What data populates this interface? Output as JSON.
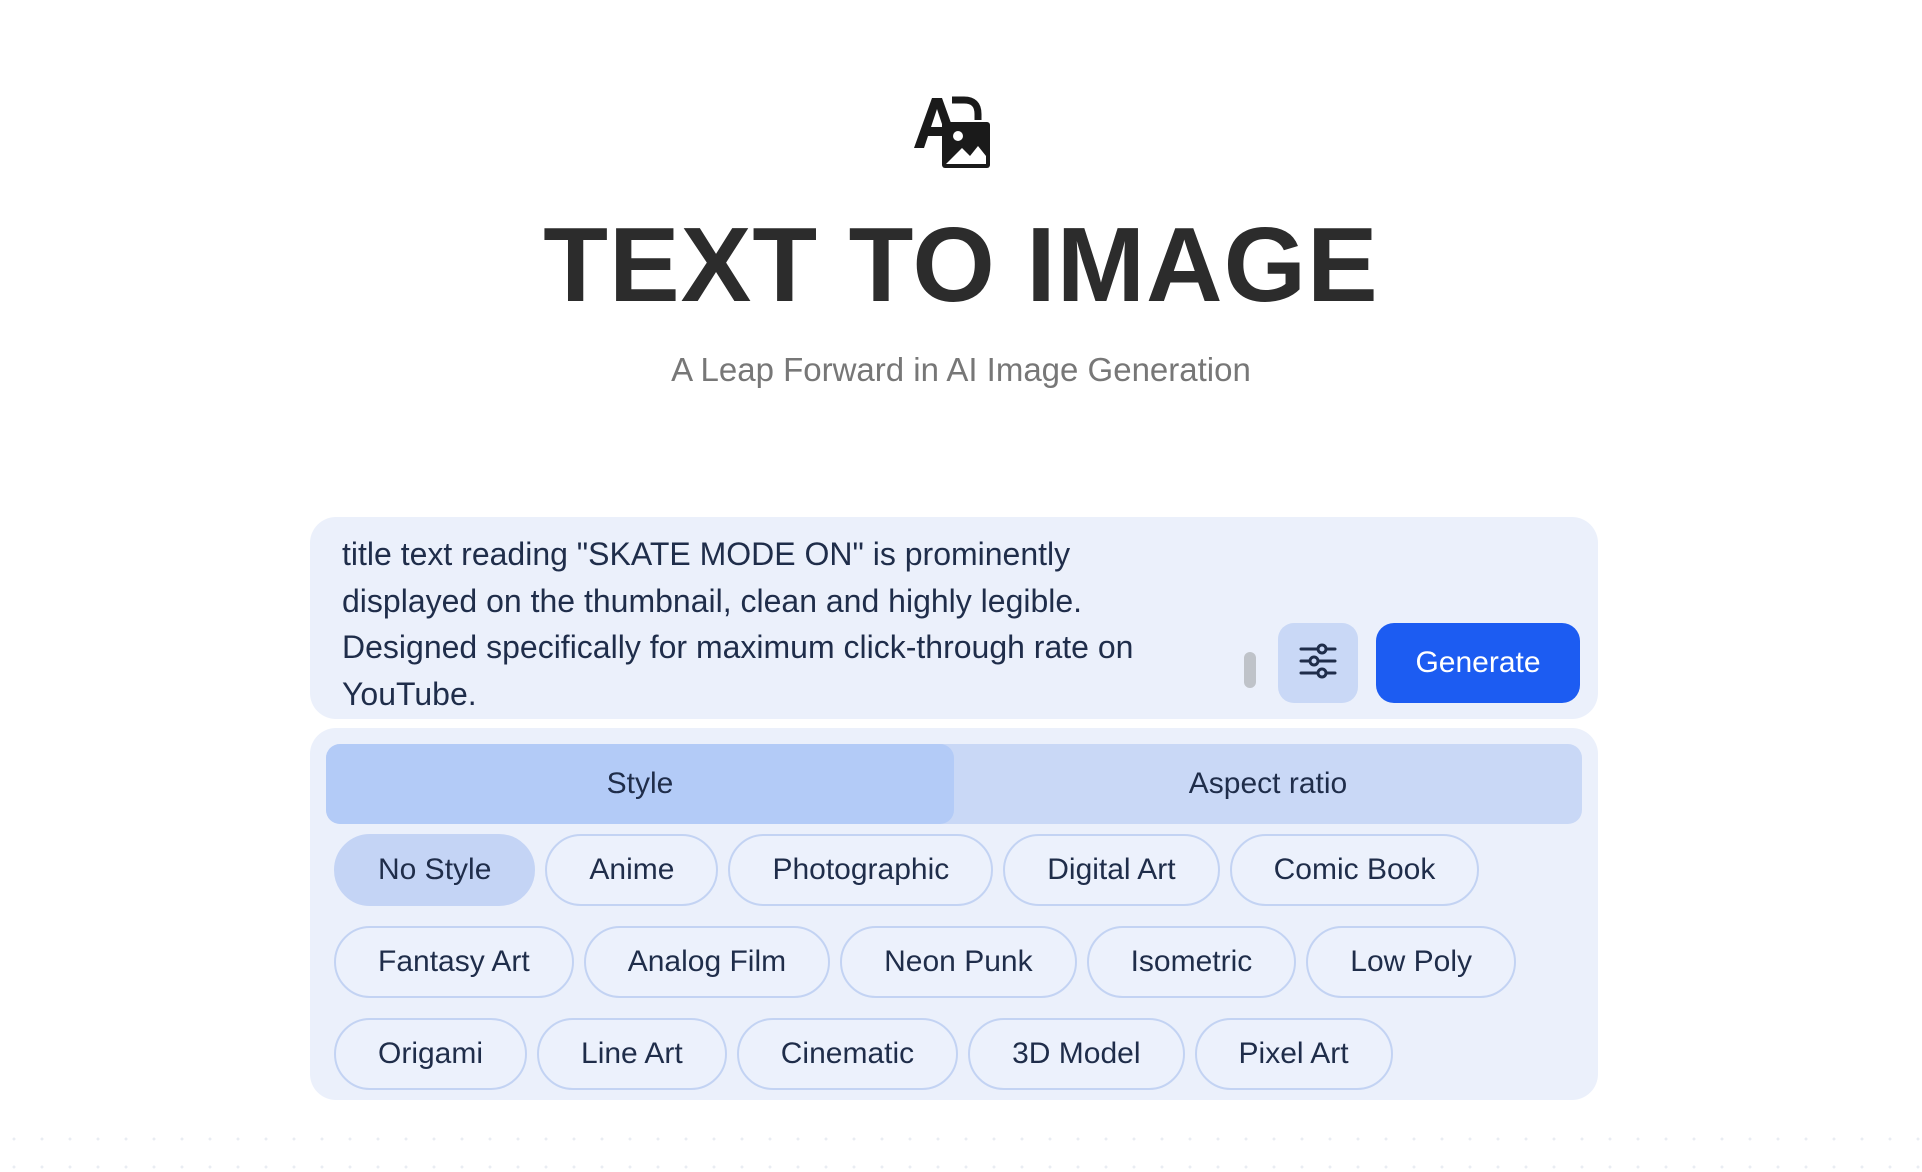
{
  "header": {
    "logo_icon": "text-to-image-icon",
    "title": "TEXT TO IMAGE",
    "subtitle": "A Leap Forward in AI Image Generation"
  },
  "prompt": {
    "value": "title text reading \"SKATE MODE ON\" is prominently\ndisplayed on the thumbnail, clean and highly legible.\nDesigned specifically for maximum click-through rate on\nYouTube.",
    "settings_icon": "sliders-icon",
    "generate_label": "Generate"
  },
  "tabs": [
    {
      "label": "Style",
      "active": true
    },
    {
      "label": "Aspect ratio",
      "active": false
    }
  ],
  "styles": {
    "row1": [
      "No Style",
      "Anime",
      "Photographic",
      "Digital Art",
      "Comic Book"
    ],
    "row2": [
      "Fantasy Art",
      "Analog Film",
      "Neon Punk",
      "Isometric",
      "Low Poly"
    ],
    "row3": [
      "Origami",
      "Line Art",
      "Cinematic",
      "3D Model",
      "Pixel Art"
    ],
    "selected": "No Style"
  },
  "colors": {
    "accent": "#1c5cf2",
    "panel": "#ebf0fb",
    "tab_active": "#b3cbf7"
  }
}
